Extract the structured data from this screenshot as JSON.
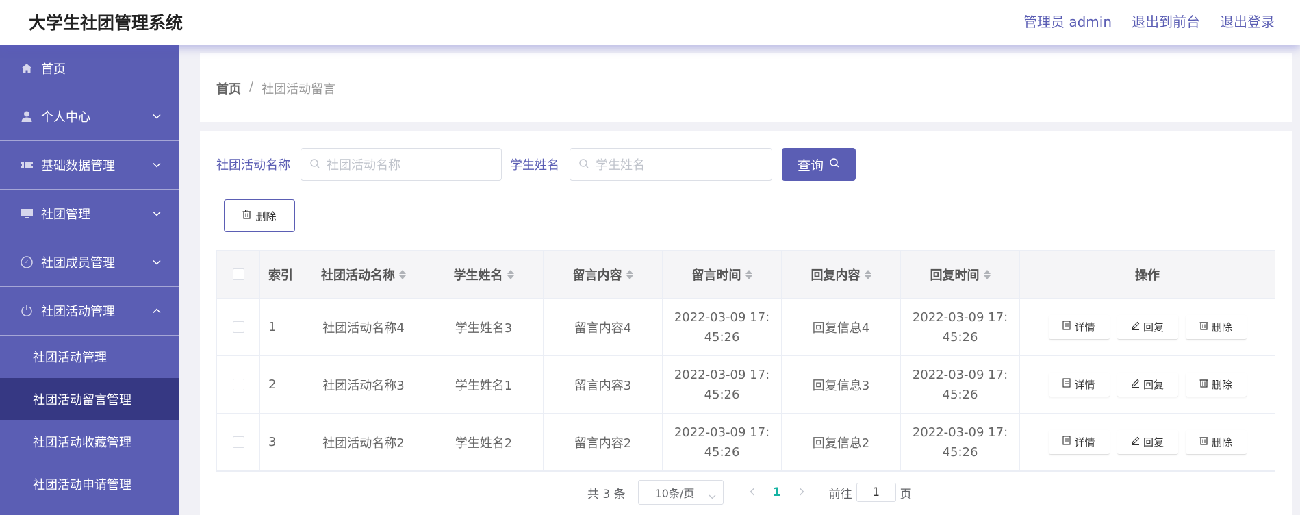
{
  "header": {
    "title": "大学生社团管理系统",
    "admin_label": "管理员 admin",
    "front_link": "退出到前台",
    "logout_link": "退出登录"
  },
  "sidebar": {
    "items": [
      {
        "label": "首页",
        "icon": "home-icon"
      },
      {
        "label": "个人中心",
        "icon": "user-icon"
      },
      {
        "label": "基础数据管理",
        "icon": "ticket-icon"
      },
      {
        "label": "社团管理",
        "icon": "monitor-icon"
      },
      {
        "label": "社团成员管理",
        "icon": "compass-icon"
      },
      {
        "label": "社团活动管理",
        "icon": "power-icon"
      }
    ],
    "submenu": [
      {
        "label": "社团活动管理"
      },
      {
        "label": "社团活动留言管理"
      },
      {
        "label": "社团活动收藏管理"
      },
      {
        "label": "社团活动申请管理"
      }
    ]
  },
  "breadcrumb": {
    "home": "首页",
    "separator": "/",
    "current": "社团活动留言"
  },
  "search": {
    "activity_label": "社团活动名称",
    "activity_placeholder": "社团活动名称",
    "student_label": "学生姓名",
    "student_placeholder": "学生姓名",
    "query_button": "查询"
  },
  "bulk_delete": "删除",
  "table": {
    "headers": {
      "index": "索引",
      "activity": "社团活动名称",
      "student": "学生姓名",
      "message": "留言内容",
      "message_time": "留言时间",
      "reply": "回复内容",
      "reply_time": "回复时间",
      "ops": "操作"
    },
    "rows": [
      {
        "index": "1",
        "activity": "社团活动名称4",
        "student": "学生姓名3",
        "message": "留言内容4",
        "message_time": "2022-03-09 17:45:26",
        "reply": "回复信息4",
        "reply_time": "2022-03-09 17:45:26"
      },
      {
        "index": "2",
        "activity": "社团活动名称3",
        "student": "学生姓名1",
        "message": "留言内容3",
        "message_time": "2022-03-09 17:45:26",
        "reply": "回复信息3",
        "reply_time": "2022-03-09 17:45:26"
      },
      {
        "index": "3",
        "activity": "社团活动名称2",
        "student": "学生姓名2",
        "message": "留言内容2",
        "message_time": "2022-03-09 17:45:26",
        "reply": "回复信息2",
        "reply_time": "2022-03-09 17:45:26"
      }
    ],
    "ops": {
      "detail": "详情",
      "reply": "回复",
      "delete": "删除"
    }
  },
  "pagination": {
    "total": "共 3 条",
    "page_size": "10条/页",
    "current_page": "1",
    "goto_label": "前往",
    "goto_value": "1",
    "page_suffix": "页"
  },
  "colors": {
    "accent": "#5b5eb4",
    "sidebar_active": "#363883",
    "page_active": "#17b3a3"
  }
}
